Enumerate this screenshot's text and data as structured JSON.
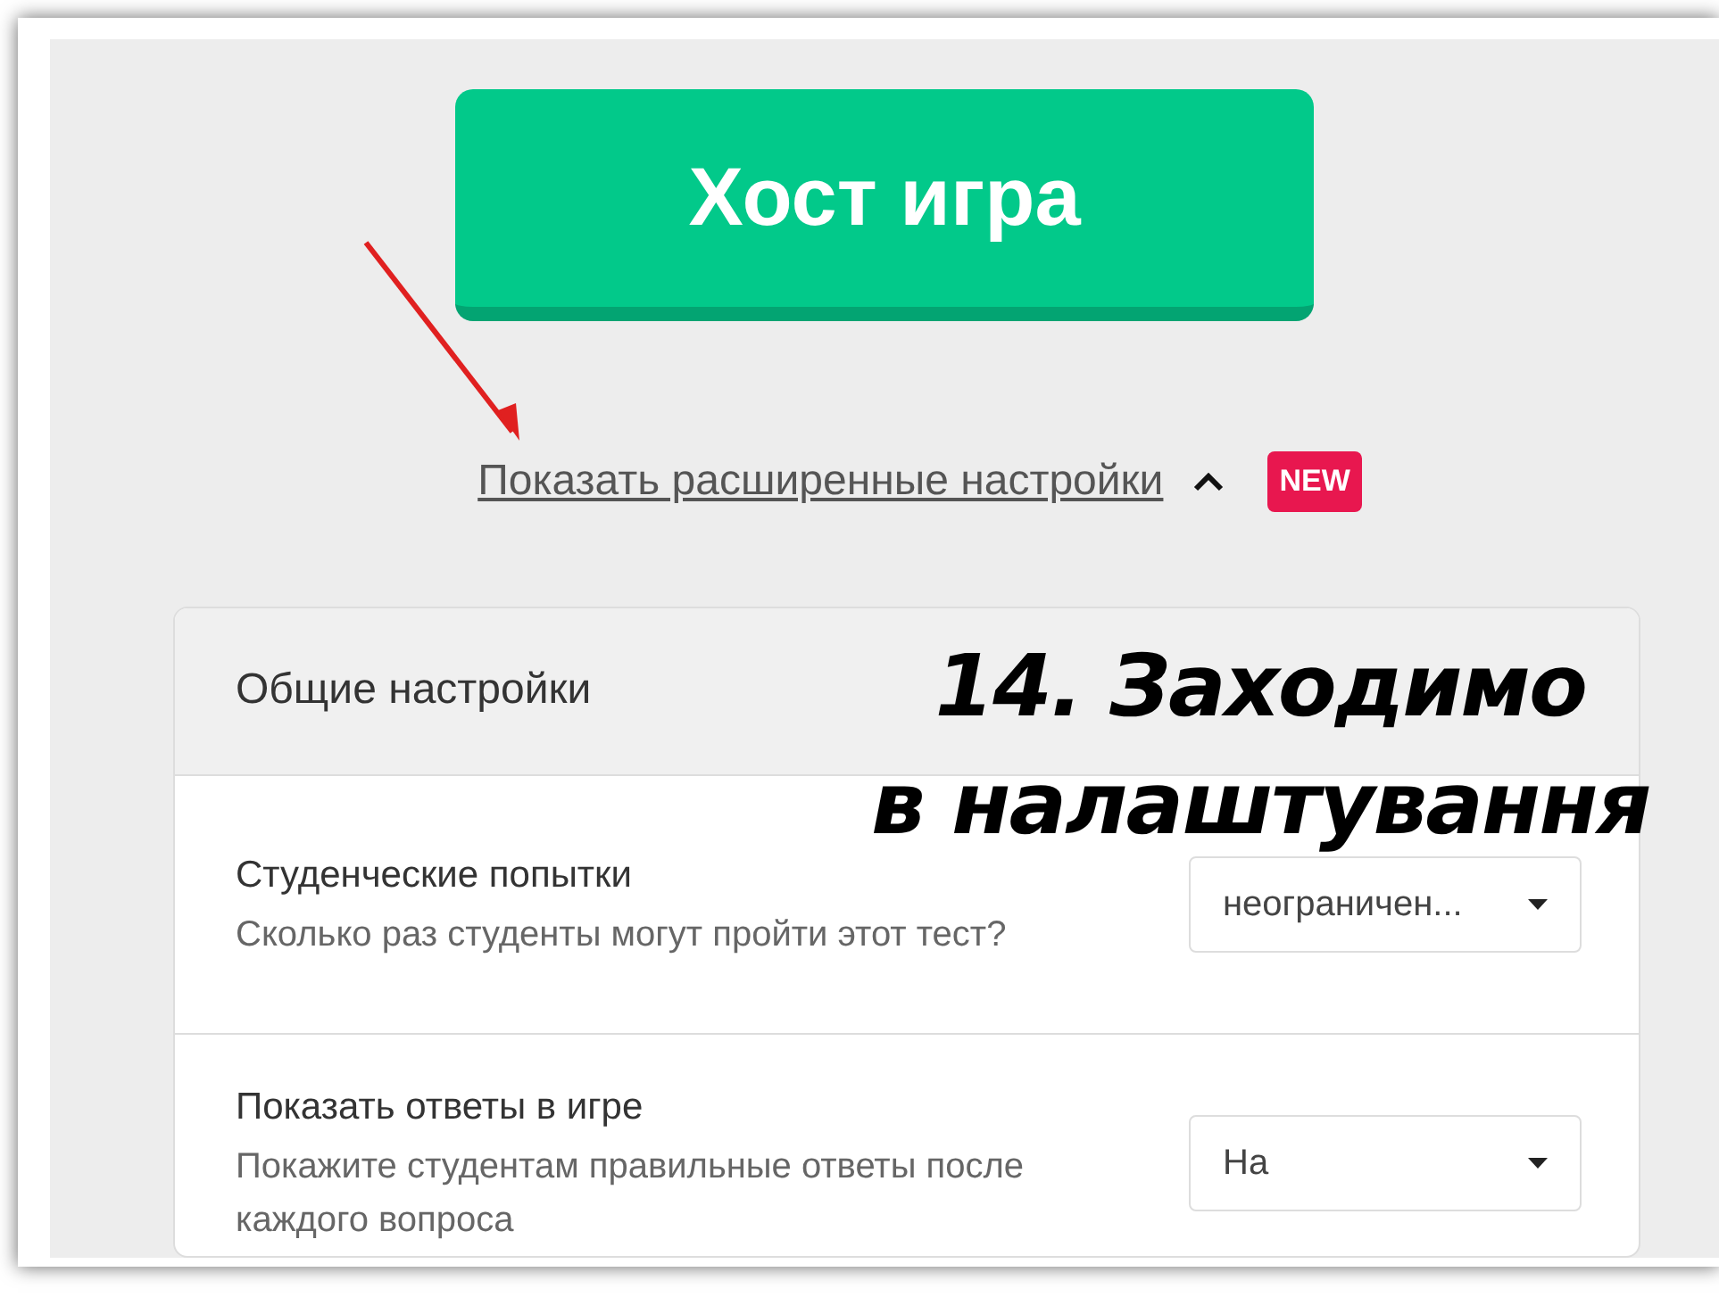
{
  "host_button": {
    "label": "Хост игра"
  },
  "advanced_settings_link": {
    "label": "Показать расширенные настройки",
    "expanded": true,
    "badge": "NEW"
  },
  "settings_panel": {
    "title": "Общие настройки",
    "rows": [
      {
        "title": "Студенческие попытки",
        "description": "Сколько раз студенты могут пройти этот тест?",
        "value": "неограничен..."
      },
      {
        "title": "Показать ответы в игре",
        "description": "Покажите студентам правильные ответы после каждого вопроса",
        "value": "На"
      }
    ]
  },
  "annotation": {
    "lines": [
      "14. Заходимо",
      "в налаштування"
    ]
  }
}
